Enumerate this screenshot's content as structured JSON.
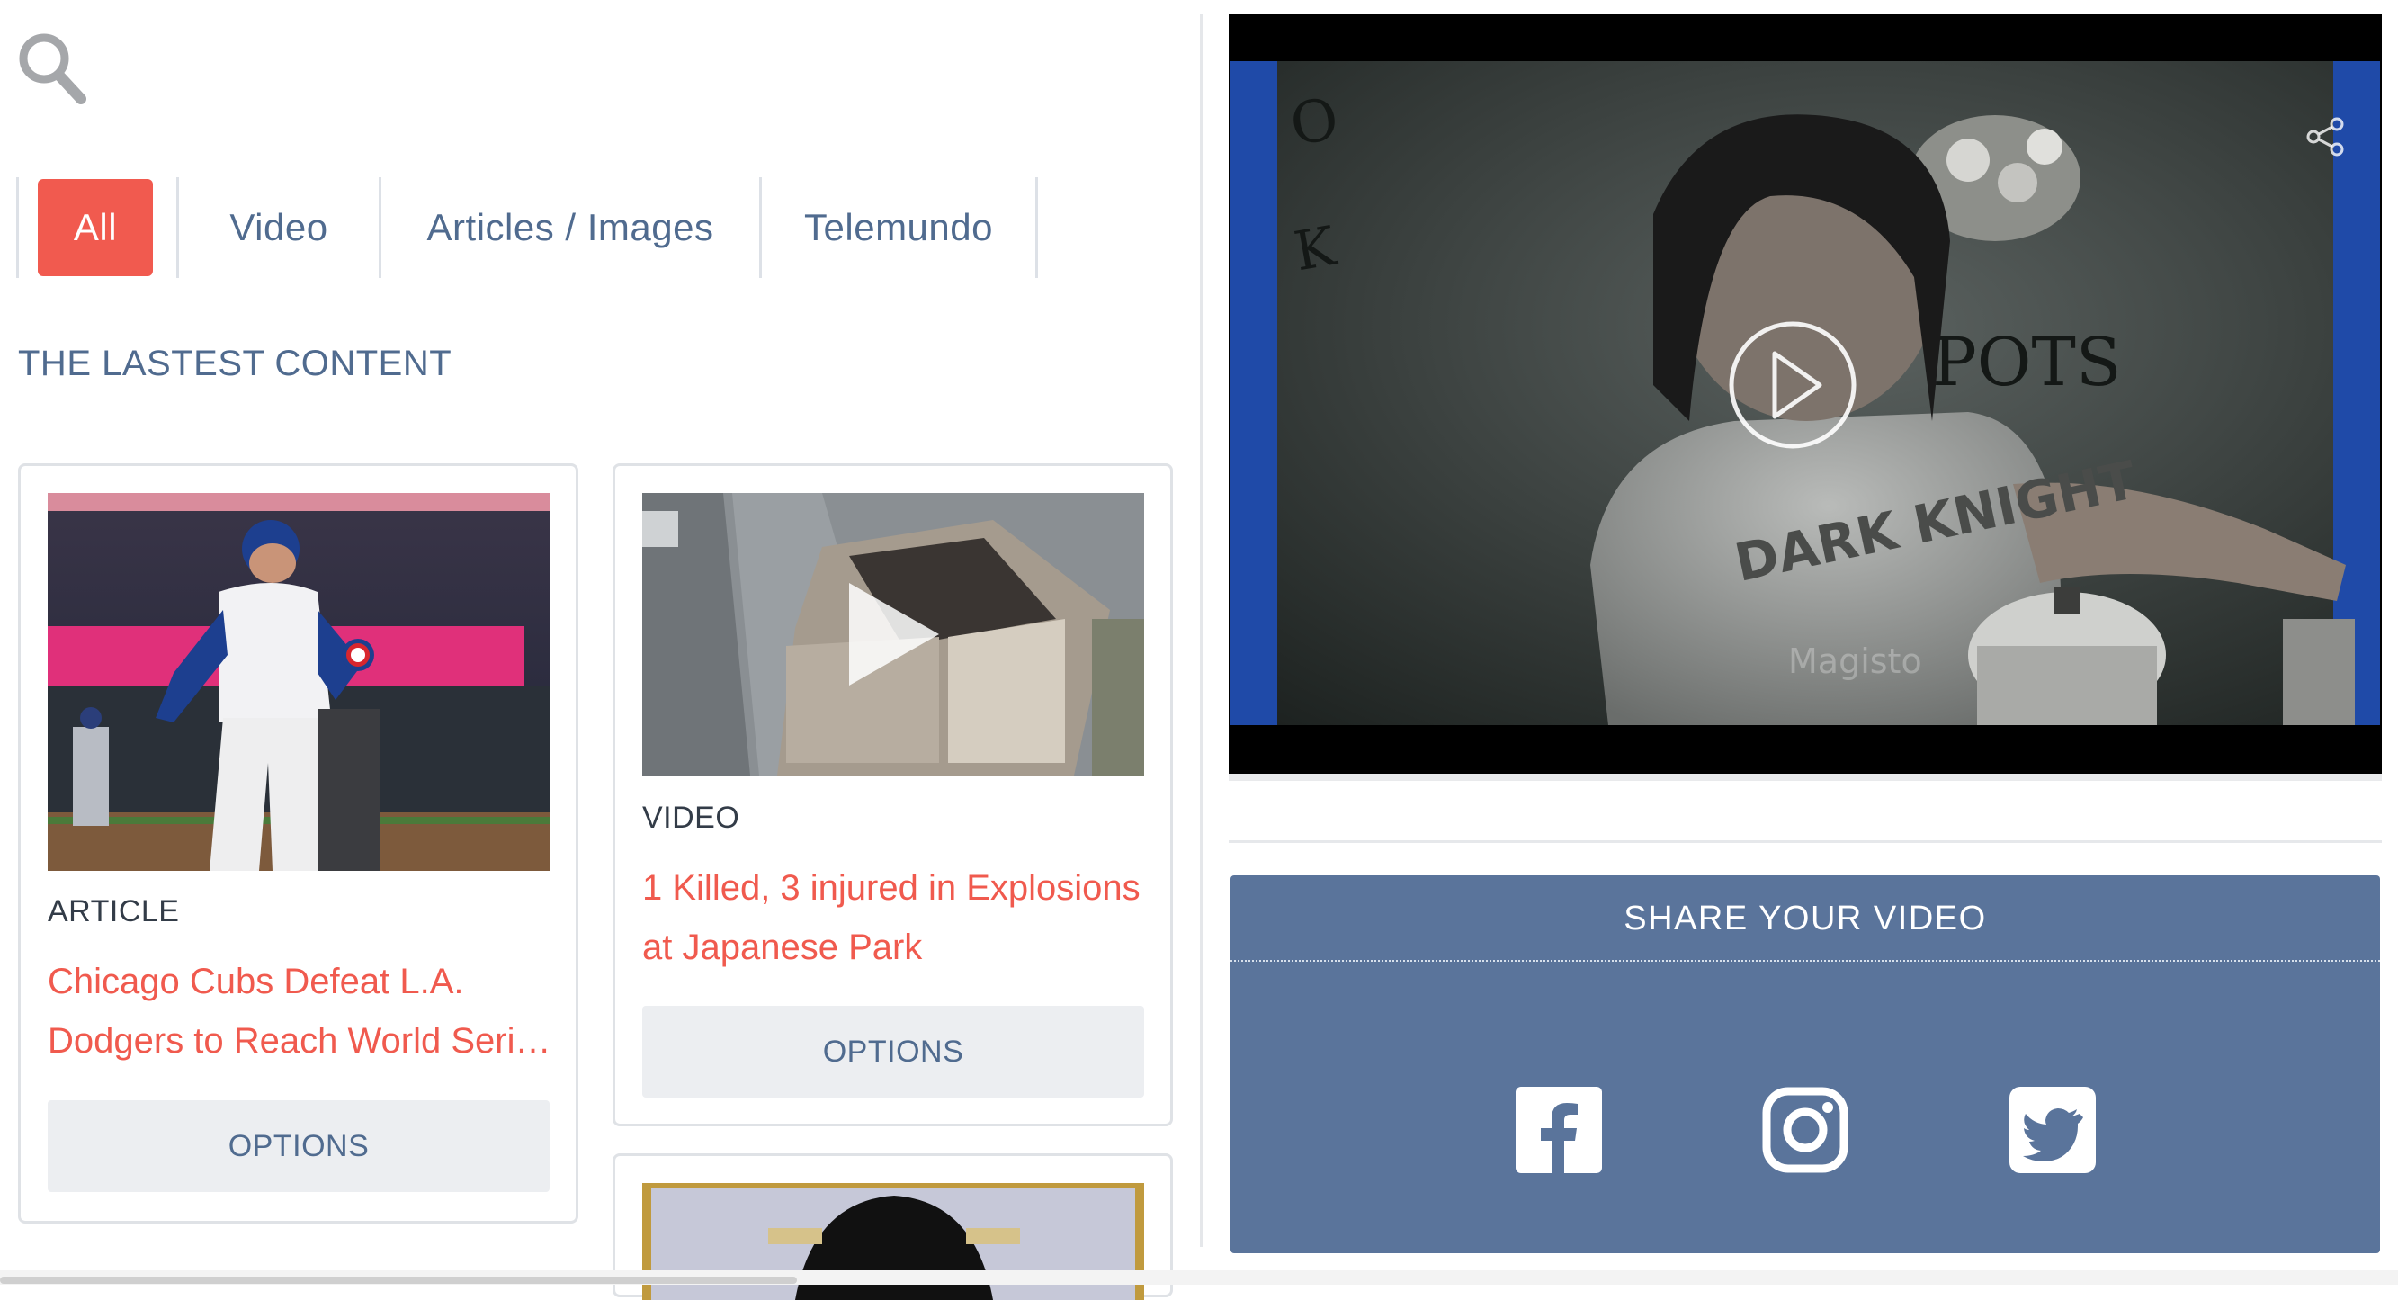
{
  "search": {
    "icon": "search-icon"
  },
  "tabs": [
    {
      "label": "All",
      "active": true
    },
    {
      "label": "Video",
      "active": false
    },
    {
      "label": "Articles / Images",
      "active": false
    },
    {
      "label": "Telemundo",
      "active": false
    }
  ],
  "section_title": "THE LASTEST CONTENT",
  "cards": [
    {
      "type": "ARTICLE",
      "title_lines": [
        "Chicago Cubs Defeat L.A.",
        "Dodgers to Reach World Series"
      ],
      "button": "OPTIONS"
    },
    {
      "type": "VIDEO",
      "title_lines": [
        "1 Killed, 3 injured in Explosions",
        "at Japanese Park"
      ],
      "button": "OPTIONS"
    }
  ],
  "player": {
    "watermark": "Magisto",
    "shirt_text": "DARK KNIGHT",
    "wall_text": "POTS",
    "icons": [
      "play-icon",
      "share-icon"
    ]
  },
  "share": {
    "title": "SHARE YOUR VIDEO",
    "networks": [
      "facebook-icon",
      "instagram-icon",
      "twitter-icon"
    ]
  },
  "colors": {
    "accent": "#f15a4f",
    "text_blue": "#506b8f",
    "share_panel": "#5a749b",
    "button_bg": "#eceef1"
  }
}
